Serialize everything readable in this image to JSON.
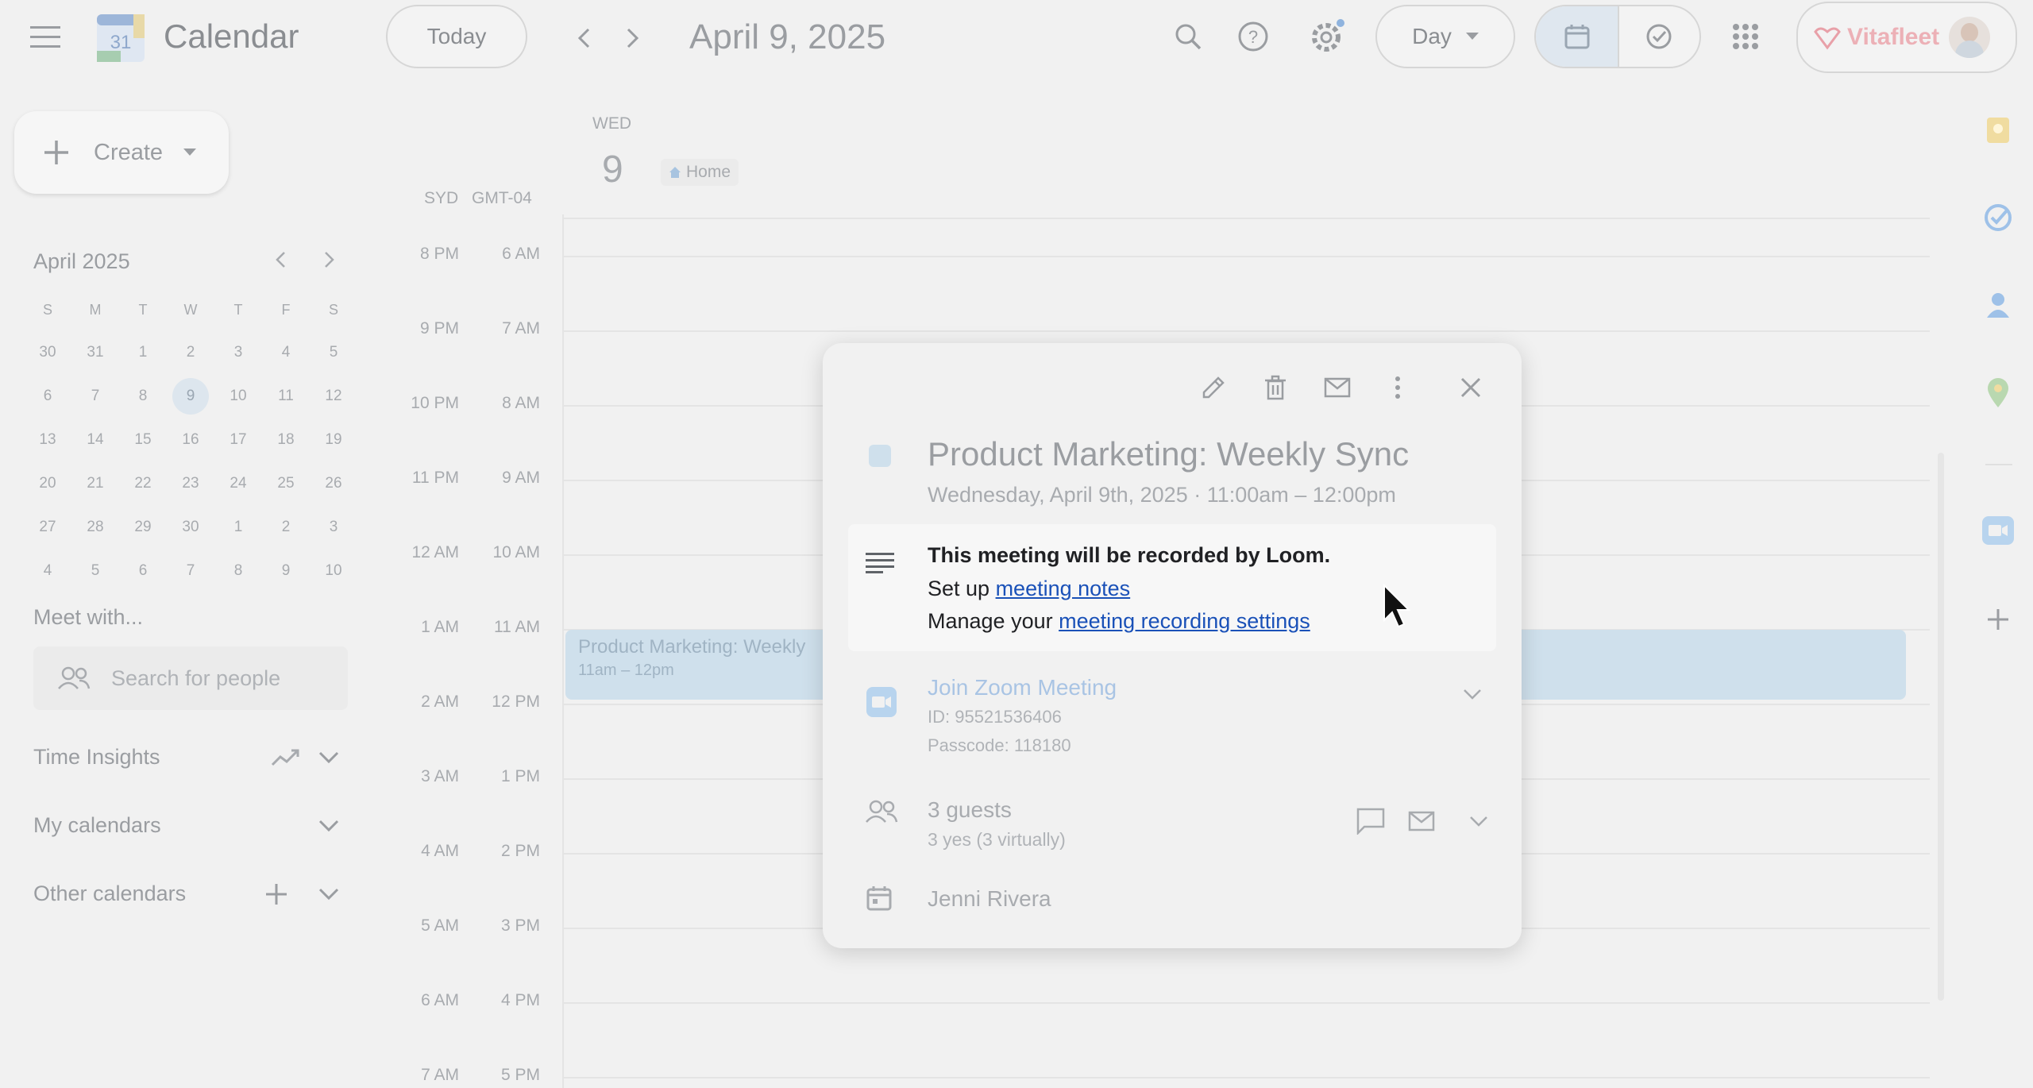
{
  "header": {
    "app_title": "Calendar",
    "logo_day": "31",
    "today_label": "Today",
    "current_date": "April 9, 2025",
    "view_label": "Day",
    "brand_label": "Vitafleet",
    "icons": [
      "menu-icon",
      "search-icon",
      "help-icon",
      "settings-icon",
      "calendar-view-icon",
      "tasks-view-icon",
      "apps-grid-icon",
      "avatar"
    ]
  },
  "sidebar": {
    "create_label": "Create",
    "mini_calendar": {
      "month": "April 2025",
      "weekday_headers": [
        "S",
        "M",
        "T",
        "W",
        "T",
        "F",
        "S"
      ],
      "weeks": [
        [
          "30",
          "31",
          "1",
          "2",
          "3",
          "4",
          "5"
        ],
        [
          "6",
          "7",
          "8",
          "9",
          "10",
          "11",
          "12"
        ],
        [
          "13",
          "14",
          "15",
          "16",
          "17",
          "18",
          "19"
        ],
        [
          "20",
          "21",
          "22",
          "23",
          "24",
          "25",
          "26"
        ],
        [
          "27",
          "28",
          "29",
          "30",
          "1",
          "2",
          "3"
        ],
        [
          "4",
          "5",
          "6",
          "7",
          "8",
          "9",
          "10"
        ]
      ],
      "selected_day": "9"
    },
    "meet_with": "Meet with...",
    "search_placeholder": "Search for people",
    "time_insights": "Time Insights",
    "my_calendars": "My calendars",
    "other_calendars": "Other calendars"
  },
  "day_view": {
    "weekday": "WED",
    "day_number": "9",
    "location_chip": "Home",
    "tz_primary": "SYD",
    "tz_secondary": "GMT-04",
    "times_primary": [
      "8 PM",
      "9 PM",
      "10 PM",
      "11 PM",
      "12 AM",
      "1 AM",
      "2 AM",
      "3 AM",
      "4 AM",
      "5 AM",
      "6 AM",
      "7 AM"
    ],
    "times_secondary": [
      "6 AM",
      "7 AM",
      "8 AM",
      "9 AM",
      "10 AM",
      "11 AM",
      "12 PM",
      "1 PM",
      "2 PM",
      "3 PM",
      "4 PM",
      "5 PM"
    ],
    "event": {
      "title": "Product Marketing: Weekly",
      "time": "11am – 12pm"
    }
  },
  "popup": {
    "title": "Product Marketing: Weekly Sync",
    "datetime": "Wednesday, April 9th, 2025 · 11:00am – 12:00pm",
    "description": {
      "line1": "This meeting will be recorded by Loom.",
      "line2_prefix": "Set up ",
      "line2_link": "meeting notes",
      "line3_prefix": "Manage your ",
      "line3_link": "meeting recording settings"
    },
    "zoom": {
      "label": "Join Zoom Meeting",
      "id": "ID: 95521536406",
      "passcode": "Passcode: 118180"
    },
    "guests": {
      "count": "3 guests",
      "summary": "3 yes (3 virtually)"
    },
    "organizer": "Jenni Rivera"
  },
  "colors": {
    "event": "#cfe0ec",
    "link": "#1a51b8",
    "accent": "#4a90d9",
    "brand": "#e8a0a8"
  }
}
